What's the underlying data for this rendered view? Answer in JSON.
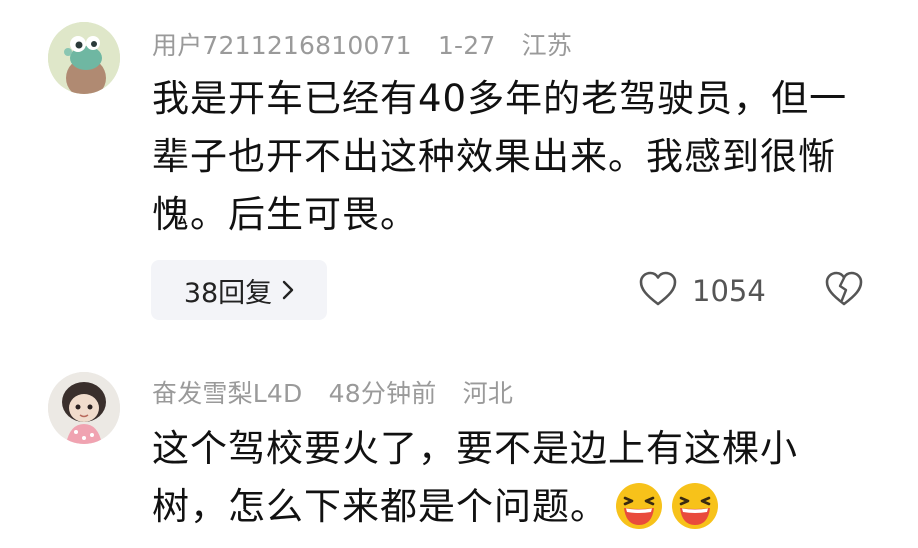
{
  "comments": [
    {
      "avatar_icon": "green-cartoon-avatar-icon",
      "username": "用户7211216810071",
      "time": "1-27",
      "location": "江苏",
      "text": "我是开车已经有40多年的老驾驶员，但一辈子也开不出这种效果出来。我感到很惭愧。后生可畏。",
      "reply_label": "38回复",
      "like_count": "1054"
    },
    {
      "avatar_icon": "doll-avatar-icon",
      "username": "奋发雪梨L4D",
      "time": "48分钟前",
      "location": "河北",
      "text": "这个驾校要火了，要不是边上有这棵小树，怎么下来都是个问题。",
      "emoji_icons": [
        "laughing-emoji-icon",
        "laughing-emoji-icon"
      ]
    }
  ],
  "icons": {
    "like": "heart-outline-icon",
    "dislike": "broken-heart-outline-icon",
    "chevron": "chevron-right-icon"
  },
  "colors": {
    "meta_text": "#9a9a9a",
    "body_text": "#111111",
    "reply_pill_bg": "#f3f4f8",
    "emoji_face": "#f7c21a",
    "emoji_mouth": "#e94b3c"
  }
}
